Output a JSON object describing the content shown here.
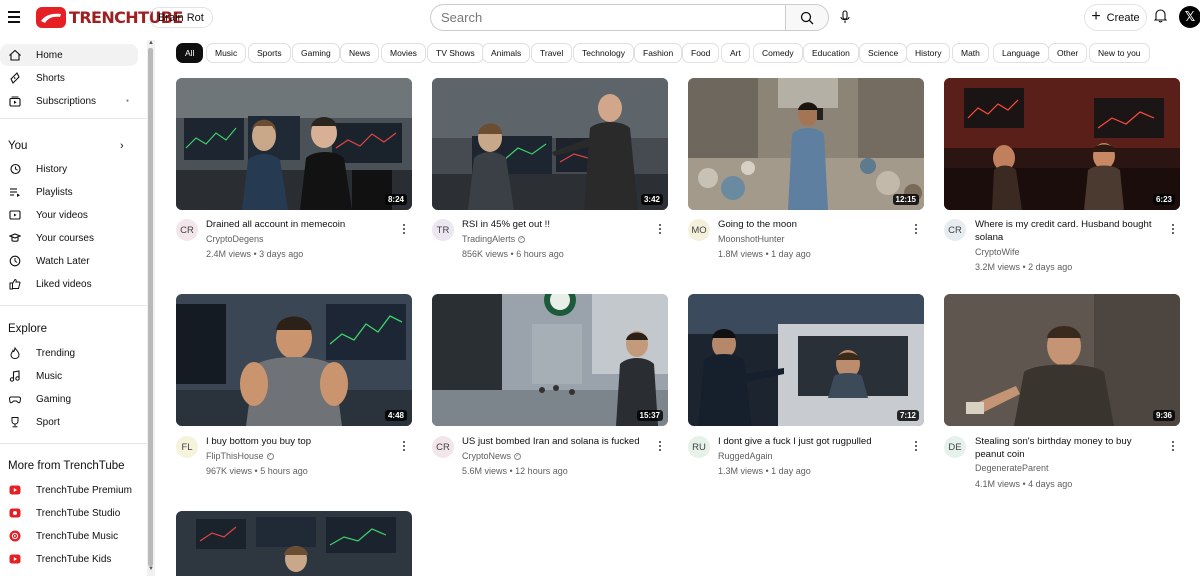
{
  "header": {
    "logo_text": "TRENCHTUBE",
    "channel_pill": "Brain Rot",
    "search_placeholder": "Search",
    "create_label": "Create",
    "avatar_letter": "𝕏"
  },
  "sidebar": {
    "main": [
      {
        "label": "Home",
        "icon": "home-icon"
      },
      {
        "label": "Shorts",
        "icon": "shorts-icon"
      },
      {
        "label": "Subscriptions",
        "icon": "subscriptions-icon"
      }
    ],
    "you_header": "You",
    "you": [
      {
        "label": "History",
        "icon": "history-icon"
      },
      {
        "label": "Playlists",
        "icon": "playlists-icon"
      },
      {
        "label": "Your videos",
        "icon": "your-videos-icon"
      },
      {
        "label": "Your courses",
        "icon": "courses-icon"
      },
      {
        "label": "Watch Later",
        "icon": "clock-icon"
      },
      {
        "label": "Liked videos",
        "icon": "thumbs-up-icon"
      }
    ],
    "explore_header": "Explore",
    "explore": [
      {
        "label": "Trending",
        "icon": "trending-icon"
      },
      {
        "label": "Music",
        "icon": "music-icon"
      },
      {
        "label": "Gaming",
        "icon": "gaming-icon"
      },
      {
        "label": "Sport",
        "icon": "trophy-icon"
      }
    ],
    "more_header": "More from TrenchTube",
    "more": [
      {
        "label": "TrenchTube Premium",
        "icon": "trenchtube-premium-icon"
      },
      {
        "label": "TrenchTube Studio",
        "icon": "trenchtube-studio-icon"
      },
      {
        "label": "TrenchTube Music",
        "icon": "trenchtube-music-icon"
      },
      {
        "label": "TrenchTube Kids",
        "icon": "trenchtube-kids-icon"
      }
    ]
  },
  "chips": [
    "All",
    "Music",
    "Sports",
    "Gaming",
    "News",
    "Movies",
    "TV Shows",
    "Animals",
    "Travel",
    "Technology",
    "Fashion",
    "Food",
    "Art",
    "Comedy",
    "Education",
    "Science",
    "History",
    "Math",
    "Language",
    "Other",
    "New to you"
  ],
  "videos": [
    {
      "title": "Drained all account in memecoin",
      "channel": "CryptoDegens",
      "verified": false,
      "initials": "CR",
      "views": "2.4M views",
      "age": "3 days ago",
      "duration": "8:24"
    },
    {
      "title": "RSI in 45% get out !!",
      "channel": "TradingAlerts",
      "verified": true,
      "initials": "TR",
      "views": "856K views",
      "age": "6 hours ago",
      "duration": "3:42"
    },
    {
      "title": "Going to the moon",
      "channel": "MoonshotHunter",
      "verified": false,
      "initials": "MO",
      "views": "1.8M views",
      "age": "1 day ago",
      "duration": "12:15"
    },
    {
      "title": "Where is my credit card. Husband bought solana",
      "channel": "CryptoWife",
      "verified": false,
      "initials": "CR",
      "views": "3.2M views",
      "age": "2 days ago",
      "duration": "6:23"
    },
    {
      "title": "I buy bottom you buy top",
      "channel": "FlipThisHouse",
      "verified": true,
      "initials": "FL",
      "views": "967K views",
      "age": "5 hours ago",
      "duration": "4:48"
    },
    {
      "title": "US just bombed Iran and solana is fucked",
      "channel": "CryptoNews",
      "verified": true,
      "initials": "CR",
      "views": "5.6M views",
      "age": "12 hours ago",
      "duration": "15:37"
    },
    {
      "title": "I dont give a fuck I just got rugpulled",
      "channel": "RuggedAgain",
      "verified": false,
      "initials": "RU",
      "views": "1.3M views",
      "age": "1 day ago",
      "duration": "7:12"
    },
    {
      "title": "Stealing son's birthday money to buy peanut coin",
      "channel": "DegenerateParent",
      "verified": false,
      "initials": "DE",
      "views": "4.1M views",
      "age": "4 days ago",
      "duration": "9:36"
    }
  ],
  "colors": {
    "brand": "#e51f23",
    "brand_text": "#9e2020"
  }
}
